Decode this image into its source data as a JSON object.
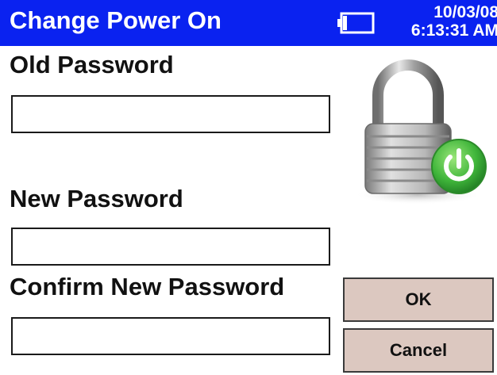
{
  "window": {
    "title": "Change Power On",
    "date": "10/03/08",
    "time": "6:13:31 AM"
  },
  "form": {
    "old_password_label": "Old Password",
    "new_password_label": "New Password",
    "confirm_password_label": "Confirm New Password",
    "old_password_value": "",
    "new_password_value": "",
    "confirm_password_value": ""
  },
  "buttons": {
    "ok_label": "OK",
    "cancel_label": "Cancel"
  },
  "icons": {
    "battery": "battery-icon",
    "lock": "padlock-power-icon"
  },
  "colors": {
    "titlebar": "#0a22f0",
    "button_bg": "#dcc8c0",
    "power_green": "#3fb53a"
  }
}
